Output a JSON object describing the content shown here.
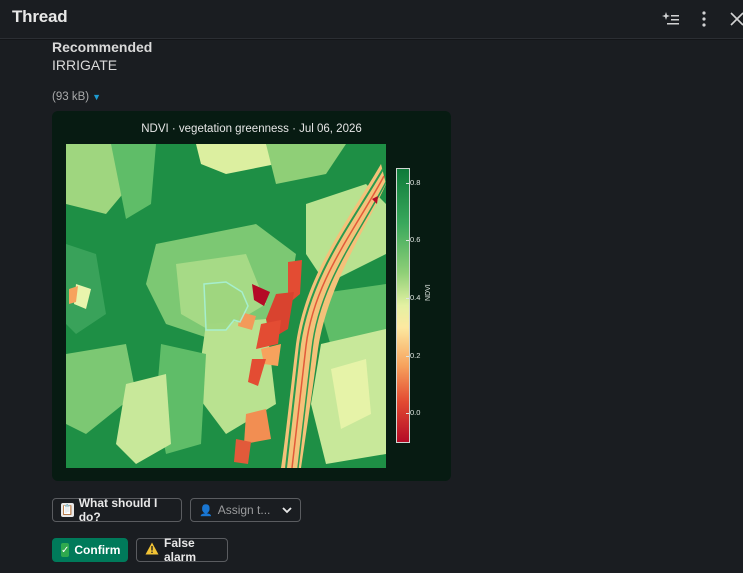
{
  "header": {
    "title": "Thread"
  },
  "message": {
    "rec_label": "Recommended",
    "rec_value": "IRRIGATE",
    "file_size": "(93 kB)"
  },
  "figure": {
    "title": "NDVI · vegetation greenness · Jul 06, 2026",
    "colorbar_label": "NDVI",
    "colorbar_ticks": [
      "0.8",
      "0.6",
      "0.4",
      "0.2",
      "0.0"
    ]
  },
  "actions": {
    "what_should_i_do": "What should I do?",
    "assign_placeholder": "Assign t...",
    "confirm": "Confirm",
    "false_alarm": "False alarm"
  },
  "colors": {
    "confirm_bg": "#007a5a",
    "link_accent": "#1d9bd1",
    "background": "#1a1d21"
  }
}
